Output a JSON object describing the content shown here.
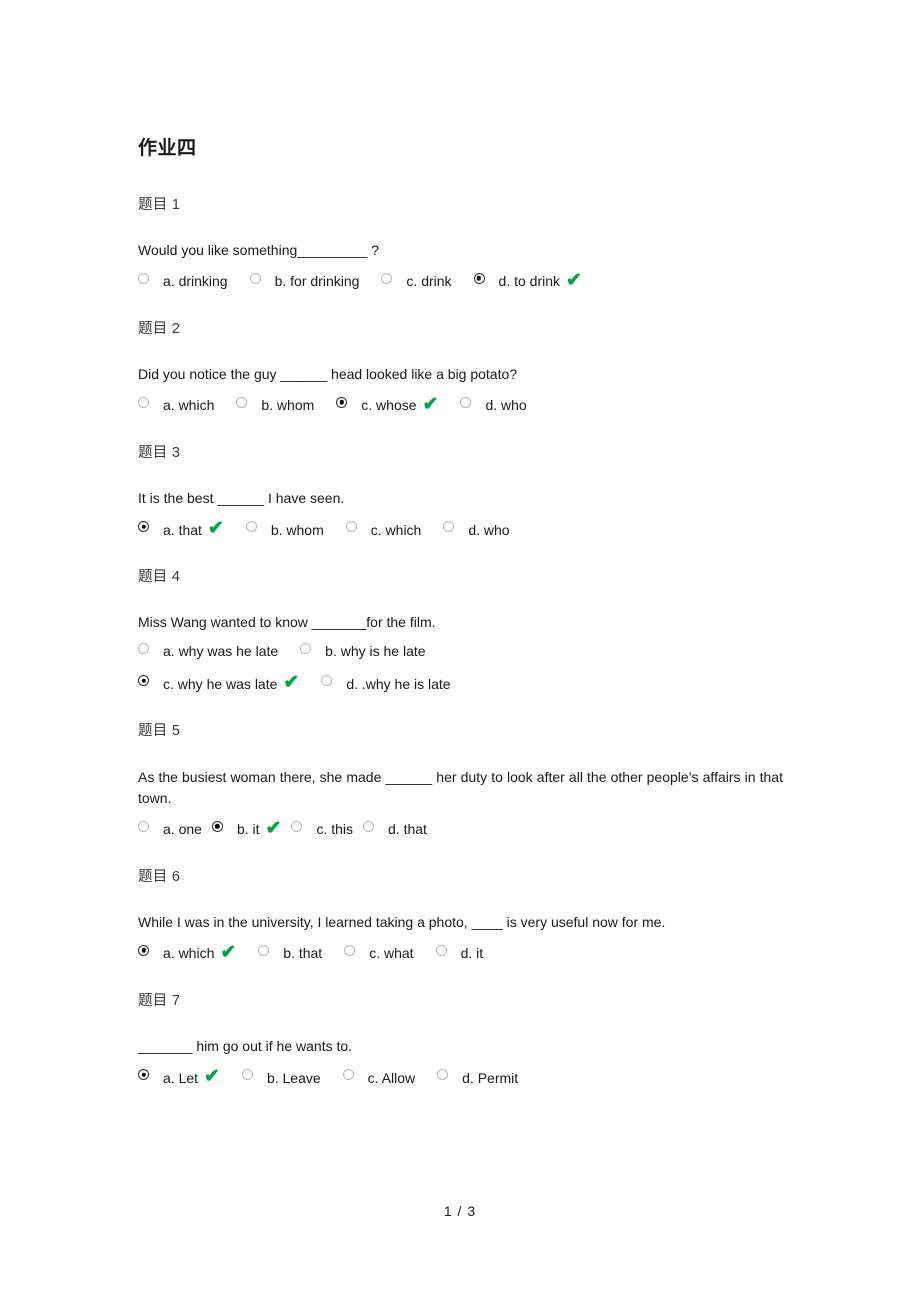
{
  "document": {
    "title": "作业四",
    "footer_page": "1 / 3"
  },
  "icons": {
    "check": "✔"
  },
  "colors": {
    "check_green": "#00a63c",
    "radio_off_border": "#b9b9b9",
    "radio_on_border": "#2f2f2f",
    "text": "#1a1a1a",
    "label": "#3a3a3a"
  },
  "questions": [
    {
      "label": "题目 1",
      "stem": "Would you like something_________ ?",
      "justified": false,
      "layout": "single-row",
      "options": [
        {
          "text": "a. drinking",
          "selected": false,
          "checked": false
        },
        {
          "text": "b. for drinking",
          "selected": false,
          "checked": false
        },
        {
          "text": "c. drink",
          "selected": false,
          "checked": false
        },
        {
          "text": "d. to drink",
          "selected": true,
          "checked": true
        }
      ]
    },
    {
      "label": "题目 2",
      "stem": "Did you notice the guy ______ head looked like a big potato?",
      "justified": false,
      "layout": "single-row",
      "options": [
        {
          "text": "a. which",
          "selected": false,
          "checked": false
        },
        {
          "text": "b. whom",
          "selected": false,
          "checked": false
        },
        {
          "text": "c. whose",
          "selected": true,
          "checked": true
        },
        {
          "text": "d. who",
          "selected": false,
          "checked": false
        }
      ]
    },
    {
      "label": "题目 3",
      "stem": "It is the best ______ I have seen.",
      "justified": false,
      "layout": "single-row",
      "options": [
        {
          "text": "a. that",
          "selected": true,
          "checked": true
        },
        {
          "text": "b. whom",
          "selected": false,
          "checked": false
        },
        {
          "text": "c. which",
          "selected": false,
          "checked": false
        },
        {
          "text": "d. who",
          "selected": false,
          "checked": false
        }
      ]
    },
    {
      "label": "题目 4",
      "stem": "Miss Wang wanted to know _______for the film.",
      "justified": false,
      "layout": "two-rows",
      "options": [
        {
          "text": "a. why was he late",
          "selected": false,
          "checked": false
        },
        {
          "text": "b. why is he late",
          "selected": false,
          "checked": false
        },
        {
          "text": "c. why he was late",
          "selected": true,
          "checked": true
        },
        {
          "text": "d. .why he is late",
          "selected": false,
          "checked": false
        }
      ]
    },
    {
      "label": "题目 5",
      "stem": "As the busiest woman there, she made ______ her duty to look after all the other people’s affairs in that town.",
      "justified": true,
      "layout": "single-row-tight",
      "options": [
        {
          "text": "a. one",
          "selected": false,
          "checked": false
        },
        {
          "text": "b. it",
          "selected": true,
          "checked": true
        },
        {
          "text": "c. this",
          "selected": false,
          "checked": false
        },
        {
          "text": "d. that",
          "selected": false,
          "checked": false
        }
      ]
    },
    {
      "label": "题目 6",
      "stem": "While I was in the university, I learned taking a photo, ____ is very useful now for me.",
      "justified": false,
      "layout": "single-row",
      "options": [
        {
          "text": "a. which",
          "selected": true,
          "checked": true
        },
        {
          "text": "b. that",
          "selected": false,
          "checked": false
        },
        {
          "text": "c. what",
          "selected": false,
          "checked": false
        },
        {
          "text": "d. it",
          "selected": false,
          "checked": false
        }
      ]
    },
    {
      "label": "题目 7",
      "stem": "_______ him go out if he wants to.",
      "justified": false,
      "layout": "single-row",
      "options": [
        {
          "text": "a. Let",
          "selected": true,
          "checked": true
        },
        {
          "text": "b. Leave",
          "selected": false,
          "checked": false
        },
        {
          "text": "c. Allow",
          "selected": false,
          "checked": false
        },
        {
          "text": "d. Permit",
          "selected": false,
          "checked": false
        }
      ]
    }
  ]
}
